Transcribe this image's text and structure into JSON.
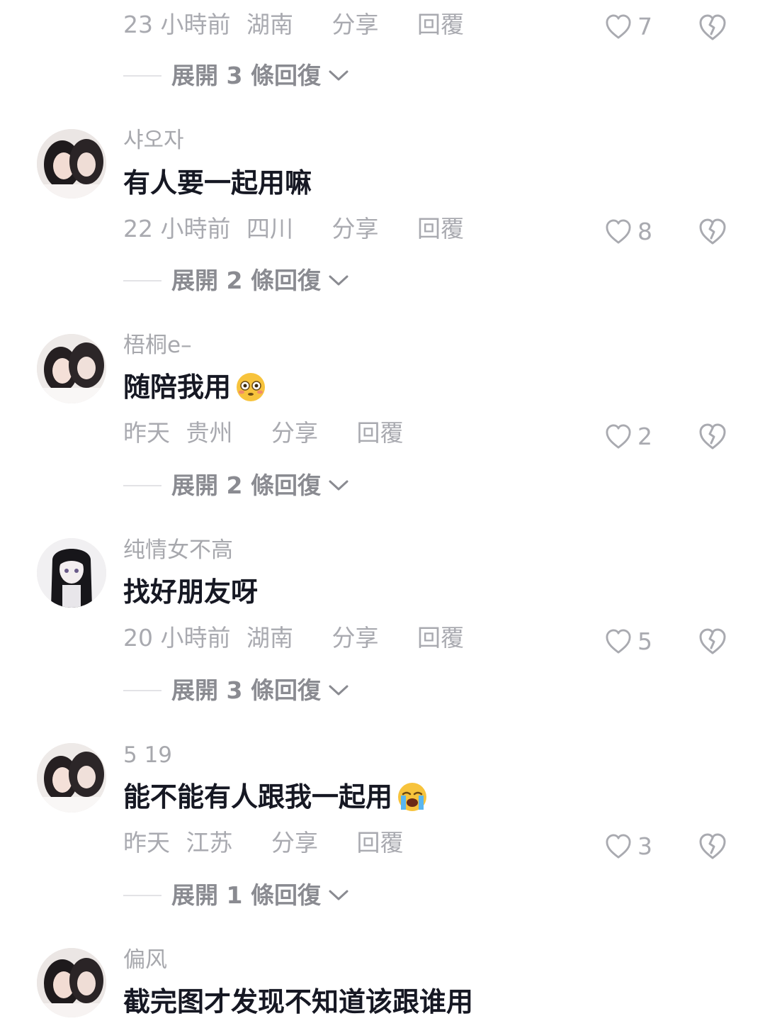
{
  "colors": {
    "primary_text": "#161823",
    "secondary_text": "#a9aab0",
    "username_text": "#a7a8ad",
    "expand_text": "#8a8b91",
    "divider": "#e3e3e6"
  },
  "comments": [
    {
      "time": "23 小時前",
      "region": "湖南",
      "share": "分享",
      "reply": "回覆",
      "likes": "7",
      "expand": "展開 3 條回復"
    },
    {
      "username": "샤오자",
      "text": "有人要一起用嘛",
      "time": "22 小時前",
      "region": "四川",
      "share": "分享",
      "reply": "回覆",
      "likes": "8",
      "expand": "展開 2 條回復"
    },
    {
      "username": "梧桐e–",
      "text": "随陪我用",
      "emoji": "flushed-face-emoji",
      "time": "昨天",
      "region": "贵州",
      "share": "分享",
      "reply": "回覆",
      "likes": "2",
      "expand": "展開 2 條回復"
    },
    {
      "username": "纯情女不高",
      "text": "找好朋友呀",
      "time": "20 小時前",
      "region": "湖南",
      "share": "分享",
      "reply": "回覆",
      "likes": "5",
      "expand": "展開 3 條回復"
    },
    {
      "username": "5 19",
      "text": "能不能有人跟我一起用",
      "emoji": "crying-face-emoji",
      "time": "昨天",
      "region": "江苏",
      "share": "分享",
      "reply": "回覆",
      "likes": "3",
      "expand": "展開 1 條回復"
    },
    {
      "username": "偏风",
      "text": "截完图才发现不知道该跟谁用"
    }
  ]
}
